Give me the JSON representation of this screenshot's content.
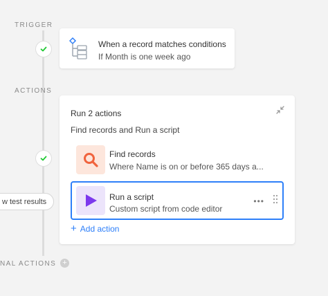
{
  "sections": {
    "trigger_label": "TRIGGER",
    "actions_label": "ACTIONS",
    "conditional_label": "NAL ACTIONS"
  },
  "trigger": {
    "title": "When a record matches conditions",
    "subtitle": "If Month is one week ago",
    "icon": "trigger-tree-icon"
  },
  "actions_card": {
    "title": "Run 2 actions",
    "subtitle": "Find records and Run a script",
    "items": [
      {
        "title": "Find records",
        "subtitle": "Where Name is on or before 365 days a...",
        "icon": "search-icon"
      },
      {
        "title": "Run a script",
        "subtitle": "Custom script from code editor",
        "icon": "play-icon"
      }
    ],
    "add_action_label": "Add action",
    "more_label": "•••"
  },
  "test_results_label": "w test results",
  "colors": {
    "accent": "#2d7ff9",
    "success": "#20c933",
    "find_bg": "#fde6dc",
    "find_icon": "#f0633d",
    "script_bg": "#ece4fb",
    "script_icon": "#7c39ed"
  }
}
